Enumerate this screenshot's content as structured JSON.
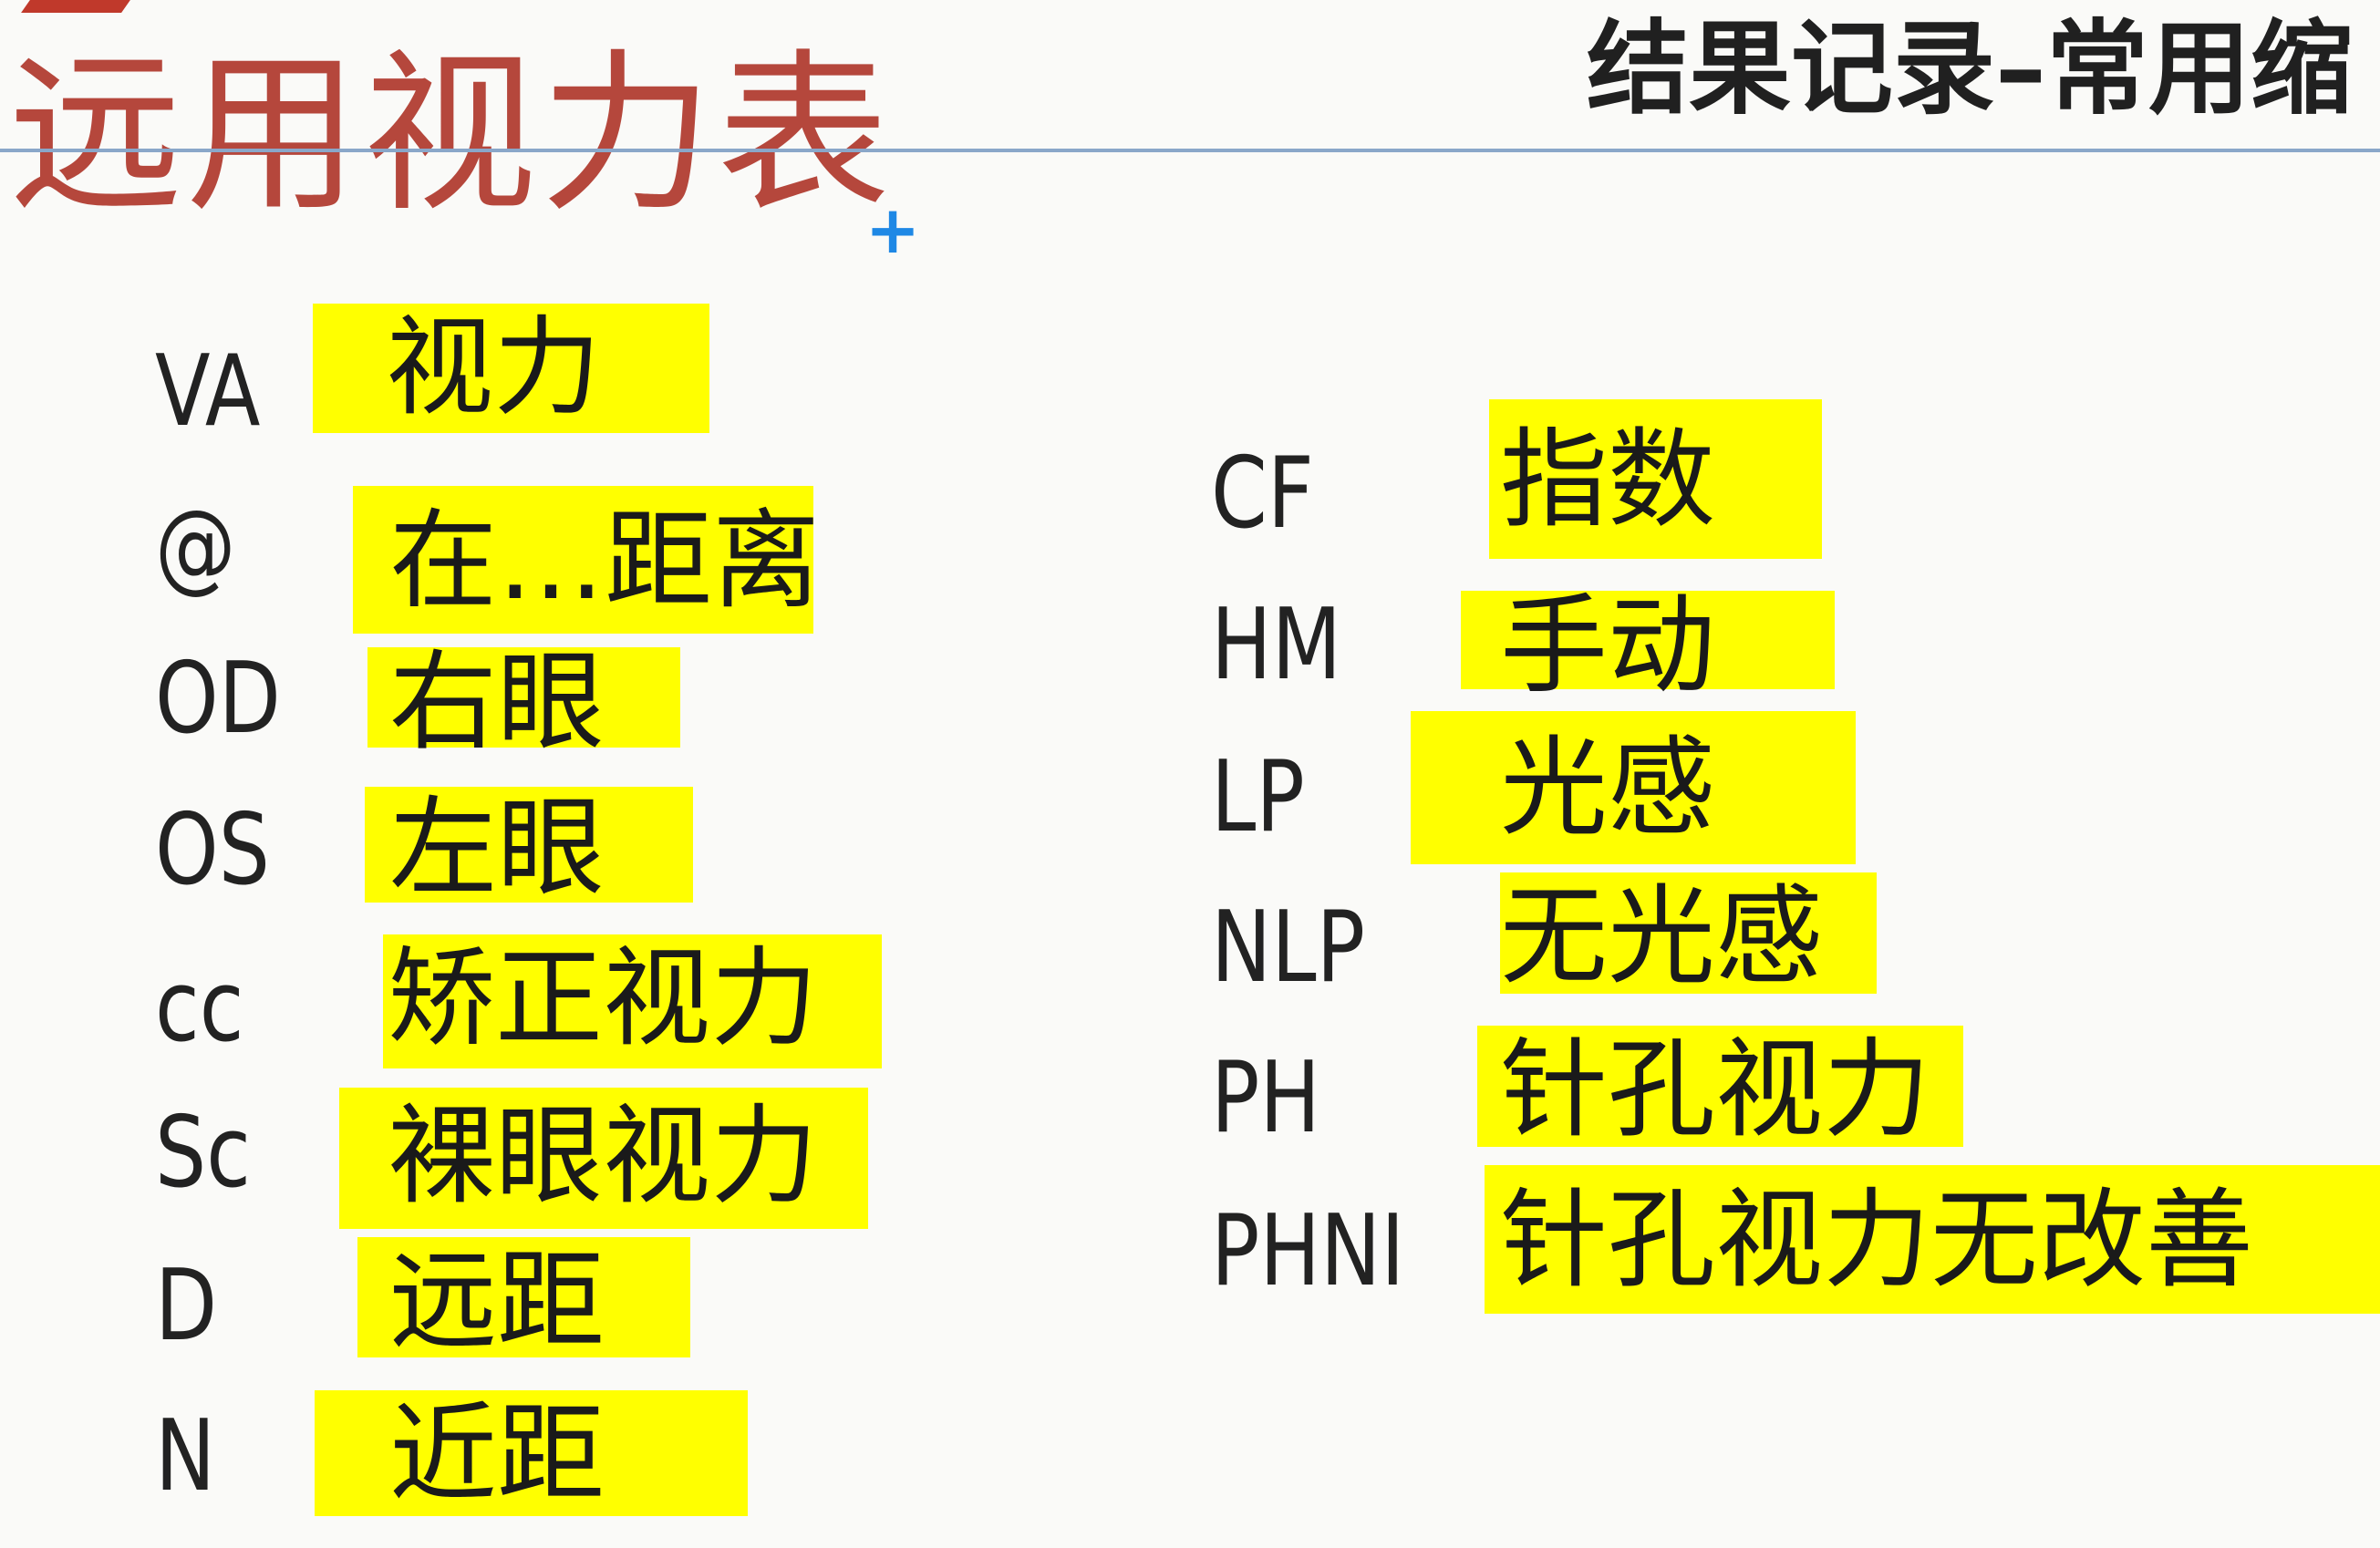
{
  "title": "远用视力表",
  "heading": "结果记录–常用缩",
  "colors": {
    "title": "#b5473c",
    "highlight": "#ffff00",
    "rule": "#8aa7c9"
  },
  "left_terms": [
    {
      "abbr": "VA",
      "meaning": "视力"
    },
    {
      "abbr": "@",
      "meaning": "在…距离"
    },
    {
      "abbr": "OD",
      "meaning": "右眼"
    },
    {
      "abbr": "OS",
      "meaning": "左眼"
    },
    {
      "abbr": "cc",
      "meaning": "矫正视力"
    },
    {
      "abbr": "Sc",
      "meaning": "裸眼视力"
    },
    {
      "abbr": "D",
      "meaning": "远距"
    },
    {
      "abbr": "N",
      "meaning": "近距"
    }
  ],
  "right_terms": [
    {
      "abbr": "CF",
      "meaning": "指数"
    },
    {
      "abbr": "HM",
      "meaning": "手动"
    },
    {
      "abbr": "LP",
      "meaning": "光感"
    },
    {
      "abbr": "NLP",
      "meaning": "无光感"
    },
    {
      "abbr": "PH",
      "meaning": "针孔视力"
    },
    {
      "abbr": "PHNI",
      "meaning": "针孔视力无改善"
    }
  ]
}
